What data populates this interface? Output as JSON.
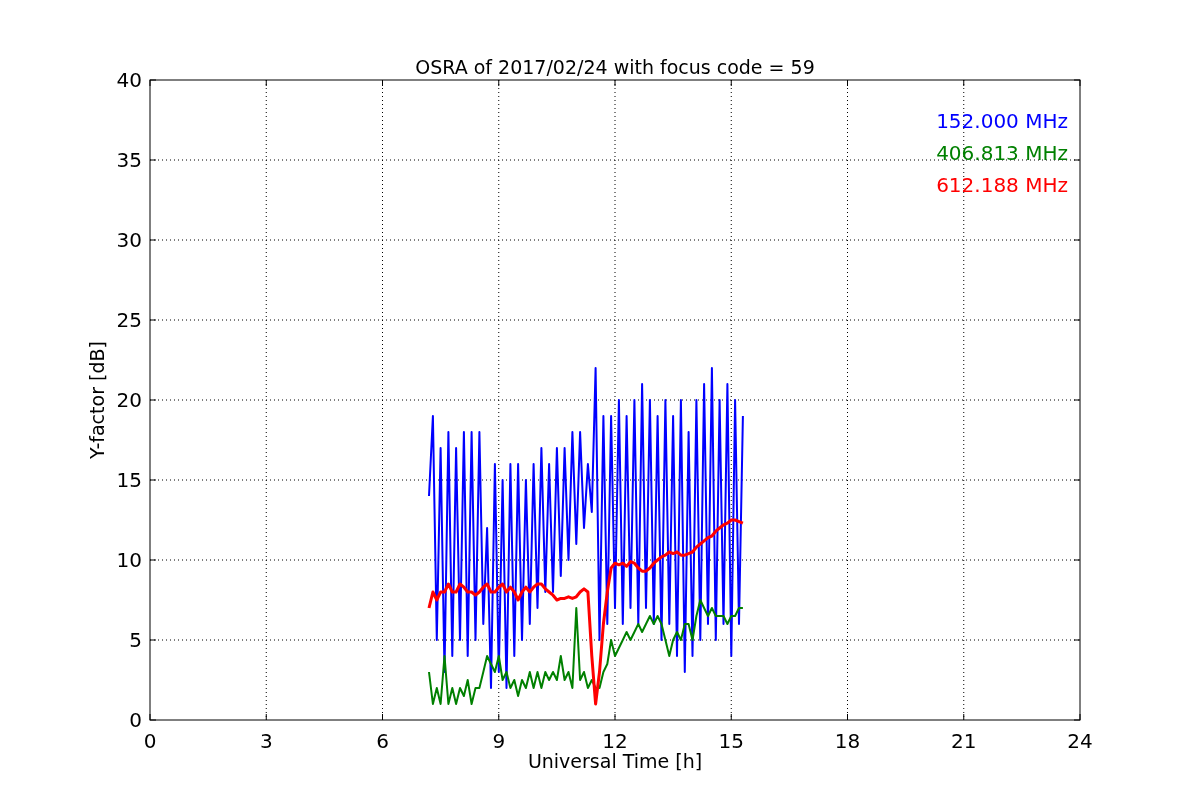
{
  "chart": {
    "chart_data": {
      "type": "line",
      "grid": true,
      "title": "OSRA of 2017/02/24 with focus code = 59",
      "xlabel": "Universal Time [h]",
      "ylabel": "Y-factor [dB]",
      "xlim": [
        0,
        24
      ],
      "ylim": [
        0,
        40
      ],
      "xticks": [
        0,
        3,
        6,
        9,
        12,
        15,
        18,
        21,
        24
      ],
      "yticks": [
        0,
        5,
        10,
        15,
        20,
        25,
        30,
        35,
        40
      ],
      "x": [
        7.2,
        7.3,
        7.4,
        7.5,
        7.6,
        7.7,
        7.8,
        7.9,
        8.0,
        8.1,
        8.2,
        8.3,
        8.4,
        8.5,
        8.6,
        8.7,
        8.8,
        8.9,
        9.0,
        9.1,
        9.2,
        9.3,
        9.4,
        9.5,
        9.6,
        9.7,
        9.8,
        9.9,
        10.0,
        10.1,
        10.2,
        10.3,
        10.4,
        10.5,
        10.6,
        10.7,
        10.8,
        10.9,
        11.0,
        11.1,
        11.2,
        11.3,
        11.4,
        11.5,
        11.6,
        11.7,
        11.8,
        11.9,
        12.0,
        12.1,
        12.2,
        12.3,
        12.4,
        12.5,
        12.6,
        12.7,
        12.8,
        12.9,
        13.0,
        13.1,
        13.2,
        13.3,
        13.4,
        13.5,
        13.6,
        13.7,
        13.8,
        13.9,
        14.0,
        14.1,
        14.2,
        14.3,
        14.4,
        14.5,
        14.6,
        14.7,
        14.8,
        14.9,
        15.0,
        15.1,
        15.2,
        15.3
      ],
      "series": [
        {
          "name": "152.000 MHz",
          "color": "#0000ff",
          "values": [
            14,
            19,
            5,
            17,
            3,
            18,
            4,
            17,
            5,
            18,
            4,
            18,
            5,
            18,
            6,
            12,
            2,
            16,
            3,
            15,
            2,
            16,
            4,
            16,
            5,
            15,
            6,
            16,
            7,
            17,
            8,
            16,
            8,
            17,
            9,
            17,
            10,
            18,
            11,
            18,
            12,
            16,
            13,
            22,
            5,
            19,
            6,
            19,
            7,
            20,
            6,
            19,
            7,
            20,
            6,
            21,
            7,
            20,
            6,
            19,
            5,
            20,
            6,
            19,
            4,
            20,
            3,
            18,
            4,
            20,
            5,
            21,
            6,
            22,
            5,
            20,
            6,
            21,
            4,
            20,
            6,
            19
          ]
        },
        {
          "name": "406.813 MHz",
          "color": "#008000",
          "values": [
            3,
            1,
            2,
            1,
            4,
            1,
            2,
            1,
            2,
            1.5,
            2.5,
            1,
            2,
            2,
            3,
            4,
            3.5,
            3,
            4,
            2.5,
            3,
            2,
            2.5,
            1.5,
            2.5,
            2,
            3,
            2,
            3,
            2,
            3,
            2.5,
            3,
            2.5,
            4,
            2.5,
            3,
            2,
            7,
            2.5,
            3,
            2,
            2.5,
            2,
            2,
            3,
            3.5,
            5,
            4,
            4.5,
            5,
            5.5,
            5,
            5.5,
            6,
            5.5,
            6,
            6.5,
            6,
            6.5,
            6,
            5,
            4,
            5,
            5.5,
            5,
            6,
            6,
            5,
            6.5,
            7.5,
            7,
            6.5,
            7,
            6.5,
            6.5,
            6.5,
            6,
            6.5,
            6.5,
            7,
            7
          ]
        },
        {
          "name": "612.188 MHz",
          "color": "#ff0000",
          "values": [
            7,
            8,
            7.5,
            8,
            8,
            8.5,
            8,
            8,
            8.5,
            8.3,
            8,
            8,
            7.8,
            8,
            8.3,
            8.5,
            8,
            8,
            8.3,
            8.5,
            8,
            8.3,
            8,
            7.5,
            8,
            8.3,
            8,
            8.3,
            8.5,
            8.5,
            8.2,
            8,
            7.8,
            7.5,
            7.6,
            7.6,
            7.7,
            7.6,
            7.7,
            8,
            8.2,
            8,
            4,
            1,
            3,
            6,
            8,
            9.5,
            9.8,
            9.7,
            9.8,
            9.6,
            9.9,
            9.8,
            9.5,
            9.3,
            9.3,
            9.5,
            9.8,
            10,
            10.2,
            10.3,
            10.5,
            10.4,
            10.5,
            10.3,
            10.3,
            10.4,
            10.5,
            10.8,
            11,
            11.2,
            11.4,
            11.5,
            11.8,
            12,
            12.2,
            12.3,
            12.5,
            12.5,
            12.4,
            12.3
          ]
        }
      ]
    }
  }
}
